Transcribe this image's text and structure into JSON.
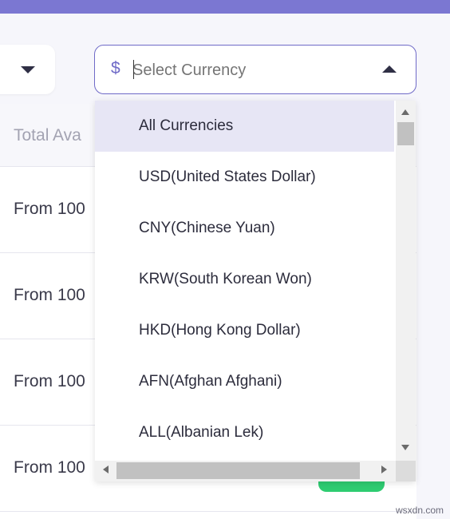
{
  "currency_select": {
    "icon": "dollar-icon",
    "icon_glyph": "$",
    "placeholder": "Select Currency"
  },
  "table": {
    "header": "Total Ava",
    "rows": [
      "From 100",
      "From 100",
      "From 100",
      "From 100"
    ]
  },
  "dropdown": {
    "options": [
      "All Currencies",
      "USD(United States Dollar)",
      "CNY(Chinese Yuan)",
      "KRW(South Korean Won)",
      "HKD(Hong Kong Dollar)",
      "AFN(Afghan Afghani)",
      "ALL(Albanian Lek)"
    ],
    "highlighted": "All Currencies"
  },
  "watermark": "wsxdn.com",
  "colors": {
    "accent": "#7b77d2",
    "highlight": "#e7e6f5",
    "badge_green": "#2ecc71"
  }
}
